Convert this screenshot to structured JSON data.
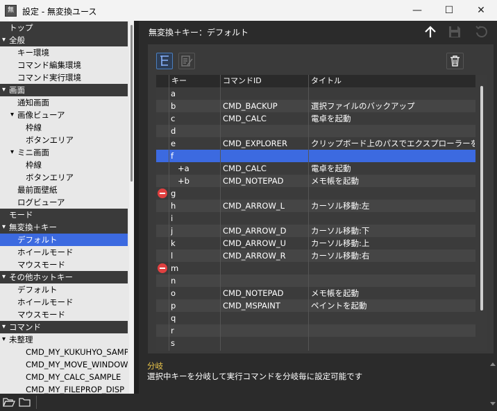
{
  "window": {
    "app_icon_text": "無変",
    "title": "設定 - 無変換ユース",
    "minimize_label": "—",
    "maximize_label": "☐",
    "close_label": "✕"
  },
  "tree": [
    {
      "label": "トップ",
      "kind": "section",
      "indent": 0
    },
    {
      "label": "全般",
      "kind": "section",
      "indent": 0,
      "expander": "▾"
    },
    {
      "label": "キー環境",
      "kind": "item",
      "indent": 1
    },
    {
      "label": "コマンド編集環境",
      "kind": "item",
      "indent": 1
    },
    {
      "label": "コマンド実行環境",
      "kind": "item",
      "indent": 1
    },
    {
      "label": "画面",
      "kind": "section",
      "indent": 0,
      "expander": "▾"
    },
    {
      "label": "通知画面",
      "kind": "item",
      "indent": 1
    },
    {
      "label": "画像ビューア",
      "kind": "item",
      "indent": 1,
      "expander": "▾"
    },
    {
      "label": "枠線",
      "kind": "item",
      "indent": 2
    },
    {
      "label": "ボタンエリア",
      "kind": "item",
      "indent": 2
    },
    {
      "label": "ミニ画面",
      "kind": "item",
      "indent": 1,
      "expander": "▾"
    },
    {
      "label": "枠線",
      "kind": "item",
      "indent": 2
    },
    {
      "label": "ボタンエリア",
      "kind": "item",
      "indent": 2
    },
    {
      "label": "最前面壁紙",
      "kind": "item",
      "indent": 1
    },
    {
      "label": "ログビューア",
      "kind": "item",
      "indent": 1
    },
    {
      "label": "モード",
      "kind": "section",
      "indent": 0
    },
    {
      "label": "無変換＋キー",
      "kind": "section",
      "indent": 0,
      "expander": "▾"
    },
    {
      "label": "デフォルト",
      "kind": "selected",
      "indent": 1
    },
    {
      "label": "ホイールモード",
      "kind": "item",
      "indent": 1
    },
    {
      "label": "マウスモード",
      "kind": "item",
      "indent": 1
    },
    {
      "label": "その他ホットキー",
      "kind": "section",
      "indent": 0,
      "expander": "▾"
    },
    {
      "label": "デフォルト",
      "kind": "item",
      "indent": 1
    },
    {
      "label": "ホイールモード",
      "kind": "item",
      "indent": 1
    },
    {
      "label": "マウスモード",
      "kind": "item",
      "indent": 1
    },
    {
      "label": "コマンド",
      "kind": "section",
      "indent": 0,
      "expander": "▾"
    },
    {
      "label": "未整理",
      "kind": "item",
      "indent": 0,
      "expander": "▾"
    },
    {
      "label": "CMD_MY_KUKUHYO_SAMPLE",
      "kind": "item",
      "indent": 2
    },
    {
      "label": "CMD_MY_MOVE_WINDOW_",
      "kind": "item",
      "indent": 2
    },
    {
      "label": "CMD_MY_CALC_SAMPLE",
      "kind": "item",
      "indent": 2
    },
    {
      "label": "CMD_MY_FILEPROP_DISP",
      "kind": "item",
      "indent": 2
    }
  ],
  "panel": {
    "title": "無変換＋キー：デフォルト",
    "up_icon": "arrow-up-icon",
    "save_icon": "save-icon",
    "revert_icon": "revert-icon",
    "branch_icon": "branch-icon",
    "edit_icon": "edit-icon",
    "delete_icon": "trash-icon"
  },
  "table": {
    "columns": [
      "キー",
      "コマンドID",
      "タイトル"
    ],
    "rows": [
      {
        "key": "a",
        "cmd": "",
        "title": ""
      },
      {
        "key": "b",
        "cmd": "CMD_BACKUP",
        "title": "選択ファイルのバックアップ"
      },
      {
        "key": "c",
        "cmd": "CMD_CALC",
        "title": "電卓を起動"
      },
      {
        "key": "d",
        "cmd": "",
        "title": ""
      },
      {
        "key": "e",
        "cmd": "CMD_EXPLORER",
        "title": "クリップボード上のパスでエクスプローラーを開く"
      },
      {
        "key": "f",
        "cmd": "",
        "title": "",
        "selected": true
      },
      {
        "key": "+a",
        "cmd": "CMD_CALC",
        "title": "電卓を起動",
        "child": true
      },
      {
        "key": "+b",
        "cmd": "CMD_NOTEPAD",
        "title": "メモ帳を起動",
        "child": true
      },
      {
        "key": "g",
        "cmd": "",
        "title": "",
        "blocked": true
      },
      {
        "key": "h",
        "cmd": "CMD_ARROW_L",
        "title": "カーソル移動:左"
      },
      {
        "key": "i",
        "cmd": "",
        "title": ""
      },
      {
        "key": "j",
        "cmd": "CMD_ARROW_D",
        "title": "カーソル移動:下"
      },
      {
        "key": "k",
        "cmd": "CMD_ARROW_U",
        "title": "カーソル移動:上"
      },
      {
        "key": "l",
        "cmd": "CMD_ARROW_R",
        "title": "カーソル移動:右"
      },
      {
        "key": "m",
        "cmd": "",
        "title": "",
        "blocked": true
      },
      {
        "key": "n",
        "cmd": "",
        "title": ""
      },
      {
        "key": "o",
        "cmd": "CMD_NOTEPAD",
        "title": "メモ帳を起動"
      },
      {
        "key": "p",
        "cmd": "CMD_MSPAINT",
        "title": "ペイントを起動"
      },
      {
        "key": "q",
        "cmd": "",
        "title": ""
      },
      {
        "key": "r",
        "cmd": "",
        "title": ""
      },
      {
        "key": "s",
        "cmd": "",
        "title": ""
      }
    ]
  },
  "description": {
    "heading": "分岐",
    "text": "選択中キーを分岐して実行コマンドを分岐毎に設定可能です"
  },
  "bottom": {
    "open_folder_icon": "folder-open-icon",
    "folder_icon": "folder-icon"
  },
  "colors": {
    "accent": "#3c6ae0",
    "section_bg": "#3a3a3a",
    "tree_bg": "#e8e8e8",
    "panel_bg": "#2b2b2b",
    "heading_yellow": "#e8c34a",
    "stop_red": "#e04040"
  }
}
